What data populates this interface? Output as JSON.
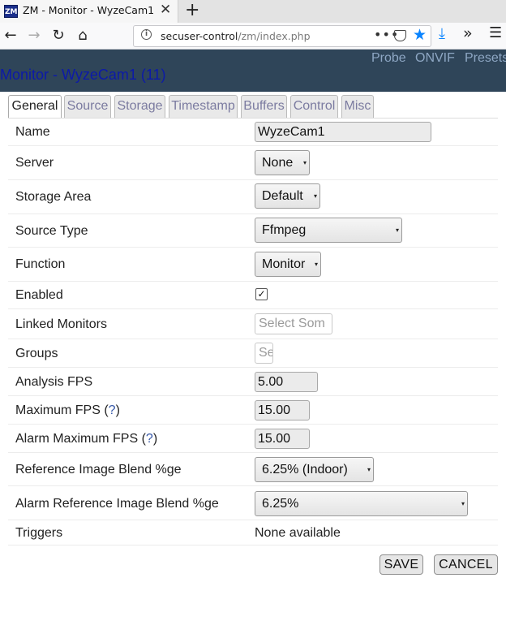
{
  "browser": {
    "tab_title": "ZM - Monitor - WyzeCam1",
    "favicon_text": "ZM",
    "url_host": "secuser-control",
    "url_path": "/zm/index.php",
    "icons": [
      "back-icon",
      "forward-icon",
      "reload-icon",
      "home-icon",
      "site-info-icon",
      "page-actions-icon",
      "pocket-icon",
      "bookmark-star-icon",
      "download-icon",
      "overflow-icon",
      "hamburger-menu-icon"
    ],
    "star_color": "#0a84ff"
  },
  "header": {
    "title": "Monitor - WyzeCam1 (11)",
    "links": [
      "Probe",
      "ONVIF",
      "Presets"
    ],
    "background": "#2f4559",
    "title_color": "#0c1aa8"
  },
  "tabs": [
    "General",
    "Source",
    "Storage",
    "Timestamp",
    "Buffers",
    "Control",
    "Misc"
  ],
  "active_tab": "General",
  "form": {
    "name_label": "Name",
    "name_value": "WyzeCam1",
    "server_label": "Server",
    "server_value": "None",
    "storage_label": "Storage Area",
    "storage_value": "Default",
    "source_type_label": "Source Type",
    "source_type_value": "Ffmpeg",
    "function_label": "Function",
    "function_value": "Monitor",
    "enabled_label": "Enabled",
    "enabled_checked": true,
    "linked_label": "Linked Monitors",
    "linked_placeholder": "Select Som",
    "groups_label": "Groups",
    "groups_placeholder": "Se",
    "analysis_fps_label": "Analysis FPS",
    "analysis_fps_value": "5.00",
    "max_fps_label": "Maximum FPS (",
    "max_fps_value": "15.00",
    "alarm_max_fps_label": "Alarm Maximum FPS (",
    "alarm_max_fps_value": "15.00",
    "help_mark": "?",
    "help_close": ")",
    "ref_blend_label": "Reference Image Blend %ge",
    "ref_blend_value": "6.25% (Indoor)",
    "alarm_ref_blend_label": "Alarm Reference Image Blend %ge",
    "alarm_ref_blend_value": "6.25%",
    "triggers_label": "Triggers",
    "triggers_value": "None available"
  },
  "buttons": {
    "save": "SAVE",
    "cancel": "CANCEL"
  }
}
